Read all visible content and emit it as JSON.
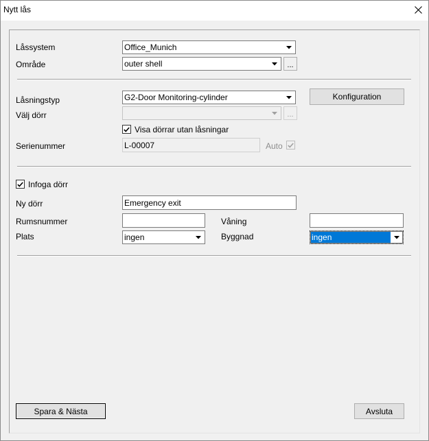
{
  "window": {
    "title": "Nytt lås"
  },
  "lock_system": {
    "label": "Låssystem",
    "value": "Office_Munich"
  },
  "area": {
    "label": "Område",
    "value": "outer shell",
    "browse_label": "..."
  },
  "lock_type": {
    "label": "Låsningstyp",
    "value": "G2-Door Monitoring-cylinder",
    "config_label": "Konfiguration"
  },
  "door": {
    "label": "Välj dörr",
    "value": "",
    "browse_label": "..."
  },
  "show_doors": {
    "label": "Visa dörrar utan låsningar",
    "checked": true
  },
  "serial": {
    "label": "Serienummer",
    "value": "L-00007",
    "auto_label": "Auto",
    "auto_checked": true
  },
  "insert_door": {
    "label": "Infoga dörr",
    "checked": true
  },
  "new_door": {
    "label": "Ny dörr",
    "value": "Emergency exit"
  },
  "room_number": {
    "label": "Rumsnummer",
    "value": ""
  },
  "floor": {
    "label": "Våning",
    "value": ""
  },
  "location": {
    "label": "Plats",
    "value": "ingen"
  },
  "building": {
    "label": "Byggnad",
    "value": "ingen"
  },
  "footer": {
    "save_next_label": "Spara & Nästa",
    "close_label": "Avsluta"
  },
  "colors": {
    "selection": "#0078d7",
    "dialog_bg": "#f0f0f0"
  }
}
